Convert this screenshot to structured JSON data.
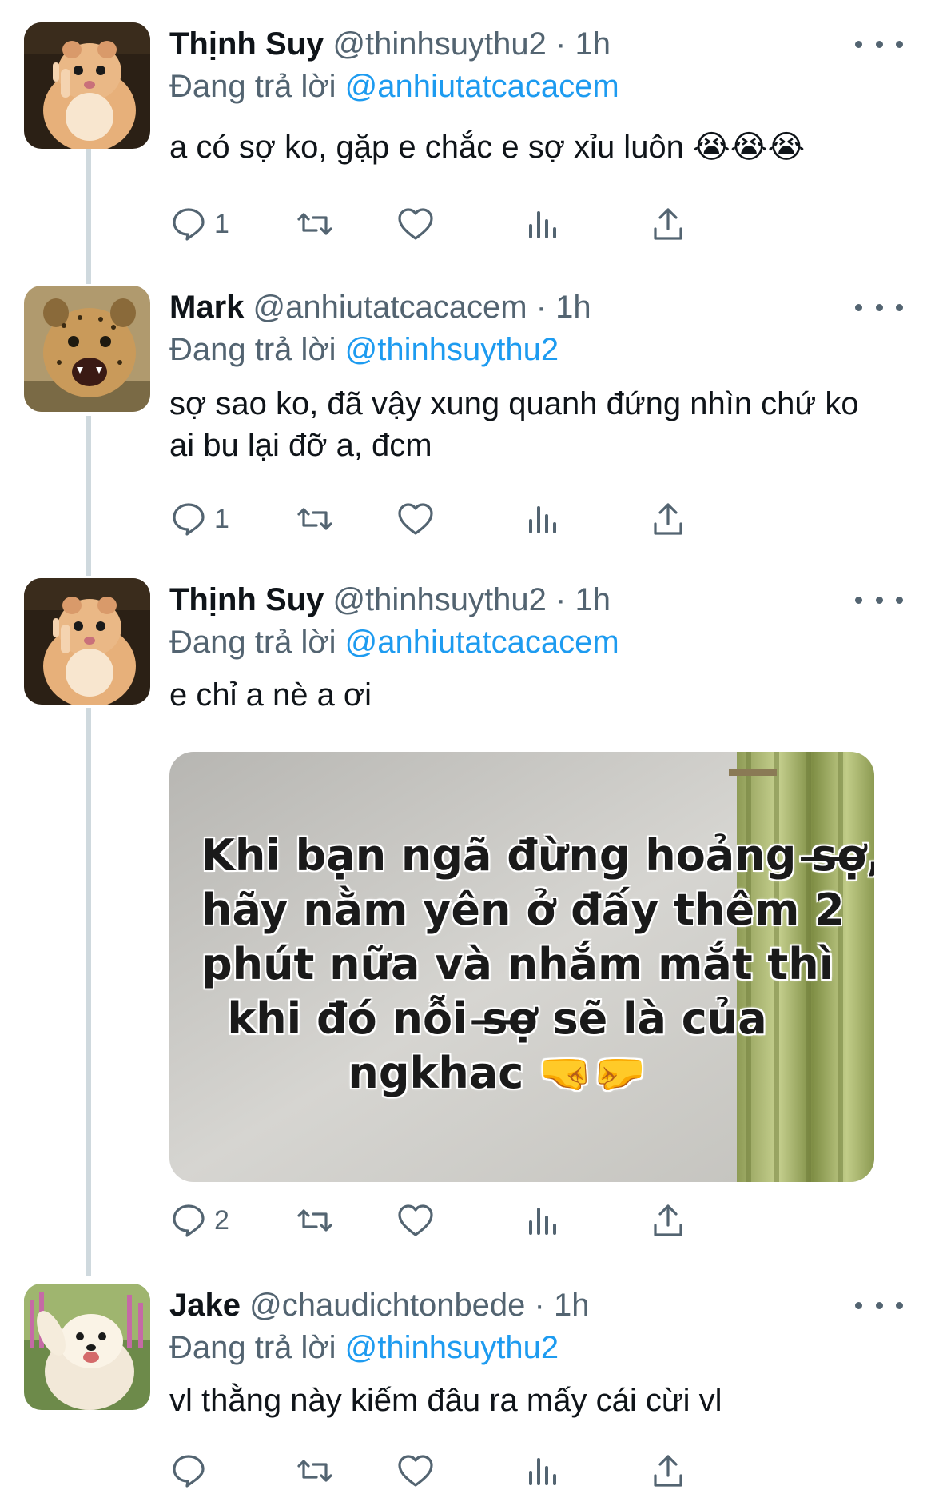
{
  "tweets": [
    {
      "name": "Thịnh Suy",
      "handle": "@thinhsuythu2",
      "dot": "·",
      "time": "1h",
      "reply_prefix": "Đang trả lời",
      "reply_to": "@anhiutatcacacem",
      "text": "a có sợ ko, gặp e chắc e sợ xỉu luôn 😭😭😭",
      "replies": "1",
      "avatar": "hamster"
    },
    {
      "name": "Mark",
      "handle": "@anhiutatcacacem",
      "dot": "·",
      "time": "1h",
      "reply_prefix": "Đang trả lời",
      "reply_to": "@thinhsuythu2",
      "text": "sợ sao ko, đã vậy xung quanh đứng nhìn chứ ko ai bu lại đỡ a, đcm",
      "replies": "1",
      "avatar": "cheetah-cub"
    },
    {
      "name": "Thịnh Suy",
      "handle": "@thinhsuythu2",
      "dot": "·",
      "time": "1h",
      "reply_prefix": "Đang trả lời",
      "reply_to": "@anhiutatcacacem",
      "text": "e chỉ a nè a ơi",
      "replies": "2",
      "avatar": "hamster",
      "media_text": [
        "Khi bạn ngã đừng hoảng s̶ợ̶,",
        "hãy nằm yên ở đấy thêm 2",
        "phút nữa và nhắm mắt thì",
        "khi đó nỗi s̶ợ̶ sẽ là của",
        "ngkhac 🤜🤛"
      ]
    },
    {
      "name": "Jake",
      "handle": "@chaudichtonbede",
      "dot": "·",
      "time": "1h",
      "reply_prefix": "Đang trả lời",
      "reply_to": "@thinhsuythu2",
      "text": "vl thằng này kiếm đâu ra mấy cái cừi vl",
      "replies": "",
      "avatar": "samoyed"
    }
  ],
  "colors": {
    "text": "#0f1419",
    "secondary": "#536471",
    "link": "#1d9bf0",
    "thread_line": "#cfd9de"
  },
  "icons": [
    "reply-icon",
    "retweet-icon",
    "like-icon",
    "views-icon",
    "share-icon",
    "more-icon"
  ]
}
